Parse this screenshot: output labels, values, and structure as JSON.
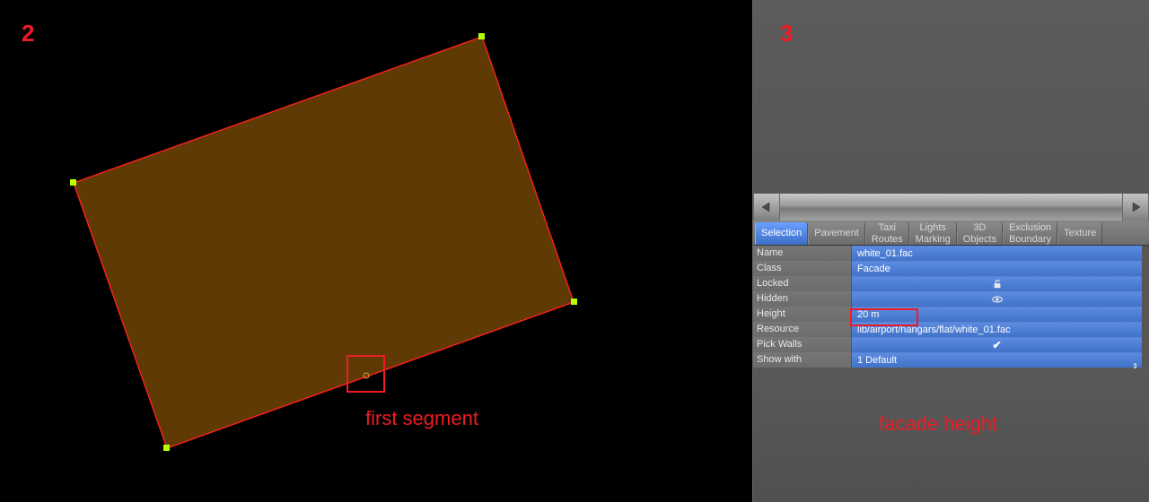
{
  "annotations": {
    "num_left": "2",
    "num_right": "3",
    "first_segment": "first segment",
    "facade_height": "facade height"
  },
  "tabs": [
    "Selection",
    "Pavement",
    "Taxi\nRoutes",
    "Lights\nMarking",
    "3D\nObjects",
    "Exclusion\nBoundary",
    "Texture"
  ],
  "properties": {
    "name_label": "Name",
    "name_value": "white_01.fac",
    "class_label": "Class",
    "class_value": "Facade",
    "locked_label": "Locked",
    "hidden_label": "Hidden",
    "height_label": "Height",
    "height_value": "20 m",
    "resource_label": "Resource",
    "resource_value": "lib/airport/hangars/flat/white_01.fac",
    "pickwalls_label": "Pick Walls",
    "showwith_label": "Show with",
    "showwith_value": "1 Default"
  }
}
